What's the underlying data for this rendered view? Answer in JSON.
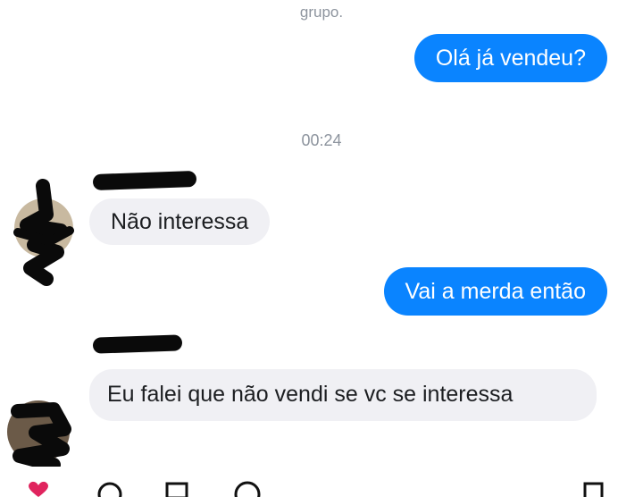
{
  "conversation": {
    "system_note": "grupo.",
    "timestamp": "00:24",
    "messages": [
      {
        "direction": "outgoing",
        "text": "Olá já vendeu?"
      },
      {
        "direction": "incoming",
        "text": "Não interessa"
      },
      {
        "direction": "outgoing",
        "text": "Vai a merda então"
      },
      {
        "direction": "incoming",
        "text": "Eu falei que não vendi se vc se interessa"
      }
    ]
  },
  "colors": {
    "outgoing_bubble": "#0a84ff",
    "incoming_bubble": "#f0f0f4",
    "meta_text": "#8d949e",
    "like_icon": "#e0245e"
  },
  "icons": [
    "heart-icon",
    "comment-icon",
    "bookmark-icon",
    "share-icon",
    "save-icon"
  ]
}
